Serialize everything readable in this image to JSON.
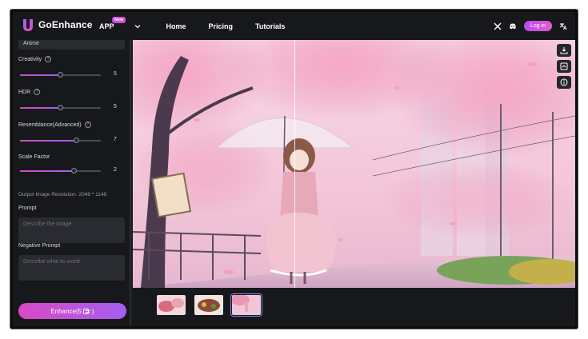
{
  "brand": {
    "name": "GoEnhance"
  },
  "nav": {
    "app_label": "APP",
    "app_badge": "New",
    "items": [
      "Home",
      "Pricing",
      "Tutorials"
    ]
  },
  "header": {
    "login_label": "Log in"
  },
  "sidebar": {
    "style_value": "Anime",
    "creativity": {
      "label": "Creativity",
      "value": "5",
      "fraction": 0.5
    },
    "hdr": {
      "label": "HDR",
      "value": "5",
      "fraction": 0.5
    },
    "resemblance": {
      "label": "Resemblance(Advanced)",
      "value": "7",
      "fraction": 0.7
    },
    "scale": {
      "label": "Scale Factor",
      "value": "2",
      "fraction": 0.67
    },
    "output_resolution": "Output Image Resolution :2048 * 1148",
    "prompt": {
      "label": "Prompt",
      "placeholder": "Describe the image"
    },
    "negative_prompt": {
      "label": "Negative Prompt",
      "placeholder": "Describe what to avoid"
    },
    "enhance_label": "Enhance(5"
  },
  "icons": {
    "close": "x-icon",
    "chat": "discord-icon",
    "language": "translate-icon",
    "download": "download-icon",
    "compare": "compare-icon",
    "info": "info-icon"
  },
  "colors": {
    "accent_start": "#d84ac4",
    "accent_end": "#a55ef0",
    "panel_bg": "#17181b"
  }
}
